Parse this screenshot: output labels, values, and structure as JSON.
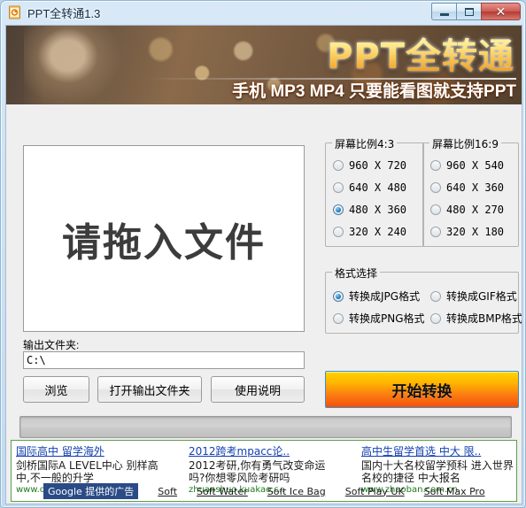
{
  "window": {
    "title": "PPT全转通1.3",
    "icon": "ppt-document-icon",
    "minimize_label": "",
    "maximize_label": "",
    "close_label": "✕"
  },
  "banner": {
    "title": "PPT全转通",
    "subtitle": "手机 MP3 MP4 只要能看图就支持PPT"
  },
  "drop_area": {
    "text": "请拖入文件"
  },
  "output": {
    "label": "输出文件夹:",
    "value": "C:\\",
    "placeholder": ""
  },
  "buttons": {
    "browse": "浏览",
    "open_folder": "打开输出文件夹",
    "help": "使用说明",
    "convert": "开始转换"
  },
  "ratio_4_3": {
    "legend": "屏幕比例4:3",
    "options": [
      {
        "label": "960 X 720",
        "selected": false
      },
      {
        "label": "640 X 480",
        "selected": false
      },
      {
        "label": "480 X 360",
        "selected": true
      },
      {
        "label": "320 X 240",
        "selected": false
      }
    ]
  },
  "ratio_16_9": {
    "legend": "屏幕比例16:9",
    "options": [
      {
        "label": "960 X 540",
        "selected": false
      },
      {
        "label": "640 X 360",
        "selected": false
      },
      {
        "label": "480 X 270",
        "selected": false
      },
      {
        "label": "320 X 180",
        "selected": false
      }
    ]
  },
  "format": {
    "legend": "格式选择",
    "options": [
      {
        "label": "转换成JPG格式",
        "selected": true
      },
      {
        "label": "转换成GIF格式",
        "selected": false
      },
      {
        "label": "转换成PNG格式",
        "selected": false
      },
      {
        "label": "转换成BMP格式",
        "selected": false
      }
    ]
  },
  "progress": {
    "percent": 0
  },
  "ads": {
    "columns": [
      {
        "title": "国际高中 留学海外",
        "body": "剑桥国际A LEVEL中心 别样高中,不一般的升学",
        "url": "www.cio-ghc.com"
      },
      {
        "title": "2012跨考mpacc论..",
        "body": "2012考研,你有勇气改变命运吗?你想零风险考研吗",
        "url": "zhuanshuo.kuakao.c.."
      },
      {
        "title": "高中生留学首选 中大 限..",
        "body": "国内十大名校留学预科 进入世界名校的捷径 中大报名",
        "url": "www.zhaoban.com.cn"
      }
    ],
    "badge": "Google 提供的广告",
    "footer_links": [
      "Soft",
      "Soft Water",
      "Soft Ice Bag",
      "Soft Play UK",
      "Soft Max Pro"
    ]
  },
  "colors": {
    "accent_orange": "#fb7b12",
    "title_gold": "#ffe98a",
    "ad_link_blue": "#1340b0",
    "ad_url_green": "#1e7a1e",
    "google_badge_blue": "#2a4b86",
    "panel_bg": "#efefef"
  }
}
